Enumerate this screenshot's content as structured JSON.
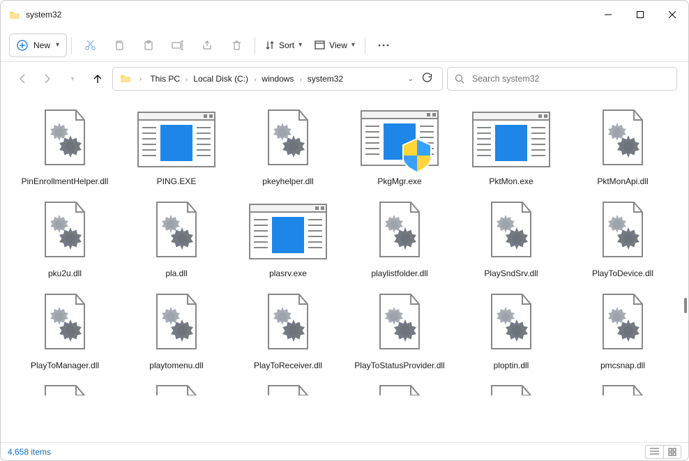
{
  "window": {
    "title": "system32"
  },
  "toolbar": {
    "new_label": "New",
    "sort_label": "Sort",
    "view_label": "View"
  },
  "breadcrumbs": [
    "This PC",
    "Local Disk (C:)",
    "windows",
    "system32"
  ],
  "search": {
    "placeholder": "Search system32"
  },
  "files": [
    {
      "name": "PinEnrollmentHelper.dll",
      "icon": "dll"
    },
    {
      "name": "PING.EXE",
      "icon": "exe"
    },
    {
      "name": "pkeyhelper.dll",
      "icon": "dll"
    },
    {
      "name": "PkgMgr.exe",
      "icon": "exe-shield"
    },
    {
      "name": "PktMon.exe",
      "icon": "exe"
    },
    {
      "name": "PktMonApi.dll",
      "icon": "dll"
    },
    {
      "name": "pku2u.dll",
      "icon": "dll"
    },
    {
      "name": "pla.dll",
      "icon": "dll"
    },
    {
      "name": "plasrv.exe",
      "icon": "exe"
    },
    {
      "name": "playlistfolder.dll",
      "icon": "dll"
    },
    {
      "name": "PlaySndSrv.dll",
      "icon": "dll"
    },
    {
      "name": "PlayToDevice.dll",
      "icon": "dll"
    },
    {
      "name": "PlayToManager.dll",
      "icon": "dll"
    },
    {
      "name": "playtomenu.dll",
      "icon": "dll"
    },
    {
      "name": "PlayToReceiver.dll",
      "icon": "dll"
    },
    {
      "name": "PlayToStatusProvider.dll",
      "icon": "dll"
    },
    {
      "name": "ploptin.dll",
      "icon": "dll"
    },
    {
      "name": "pmcsnap.dll",
      "icon": "dll"
    }
  ],
  "partial_row_count": 6,
  "status": {
    "item_count": "4,658 items"
  }
}
